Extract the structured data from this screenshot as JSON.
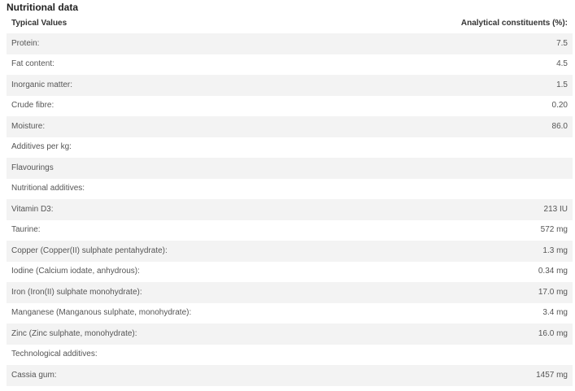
{
  "title": "Nutritional data",
  "header": {
    "label": "Typical Values",
    "value": "Analytical constituents (%):"
  },
  "rows": [
    {
      "label": "Protein:",
      "value": "7.5"
    },
    {
      "label": "Fat content:",
      "value": "4.5"
    },
    {
      "label": "Inorganic matter:",
      "value": "1.5"
    },
    {
      "label": "Crude fibre:",
      "value": "0.20"
    },
    {
      "label": "Moisture:",
      "value": "86.0"
    },
    {
      "label": "Additives per kg:",
      "value": ""
    },
    {
      "label": "Flavourings",
      "value": ""
    },
    {
      "label": "Nutritional additives:",
      "value": ""
    },
    {
      "label": "Vitamin D3:",
      "value": "213 IU"
    },
    {
      "label": "Taurine:",
      "value": "572 mg"
    },
    {
      "label": "Copper (Copper(II) sulphate pentahydrate):",
      "value": "1.3 mg"
    },
    {
      "label": "Iodine (Calcium iodate, anhydrous):",
      "value": "0.34 mg"
    },
    {
      "label": "Iron (Iron(II) sulphate monohydrate):",
      "value": "17.0 mg"
    },
    {
      "label": "Manganese (Manganous sulphate, monohydrate):",
      "value": "3.4 mg"
    },
    {
      "label": "Zinc (Zinc sulphate, monohydrate):",
      "value": "16.0 mg"
    },
    {
      "label": "Technological additives:",
      "value": ""
    },
    {
      "label": "Cassia gum:",
      "value": "1457 mg"
    }
  ]
}
